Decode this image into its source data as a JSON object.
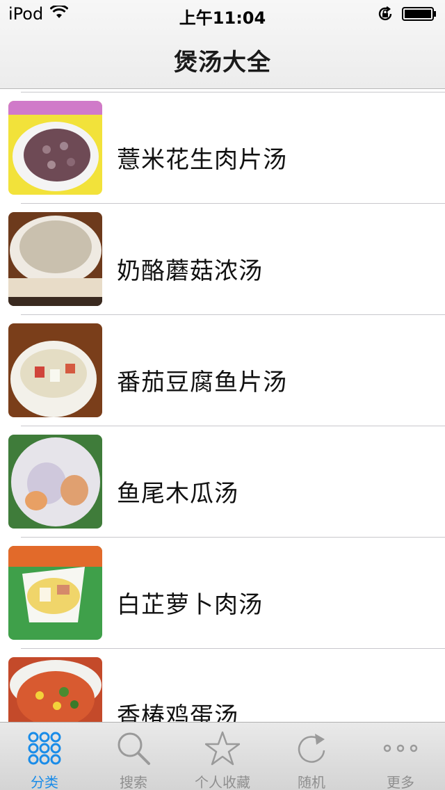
{
  "status_bar": {
    "carrier": "iPod",
    "time": "上午11:04",
    "icons": [
      "wifi-icon",
      "rotation-lock-icon",
      "battery-icon"
    ]
  },
  "nav": {
    "title": "煲汤大全"
  },
  "list": {
    "items": [
      {
        "title": "薏米花生肉片汤",
        "image": "soup-photo-thumbnail"
      },
      {
        "title": "奶酪蘑菇浓汤",
        "image": "soup-photo-thumbnail"
      },
      {
        "title": "番茄豆腐鱼片汤",
        "image": "soup-photo-thumbnail"
      },
      {
        "title": "鱼尾木瓜汤",
        "image": "soup-photo-thumbnail"
      },
      {
        "title": "白芷萝卜肉汤",
        "image": "soup-photo-thumbnail"
      },
      {
        "title": "香椿鸡蛋汤",
        "image": "soup-photo-thumbnail"
      }
    ]
  },
  "tab_bar": {
    "tabs": [
      {
        "label": "分类",
        "icon": "grid-dots-icon",
        "active": true
      },
      {
        "label": "搜索",
        "icon": "search-icon",
        "active": false
      },
      {
        "label": "个人收藏",
        "icon": "star-icon",
        "active": false
      },
      {
        "label": "随机",
        "icon": "refresh-icon",
        "active": false
      },
      {
        "label": "更多",
        "icon": "more-dots-icon",
        "active": false
      }
    ]
  },
  "colors": {
    "accent": "#1a8ce8",
    "inactive": "#8f8f8f"
  }
}
